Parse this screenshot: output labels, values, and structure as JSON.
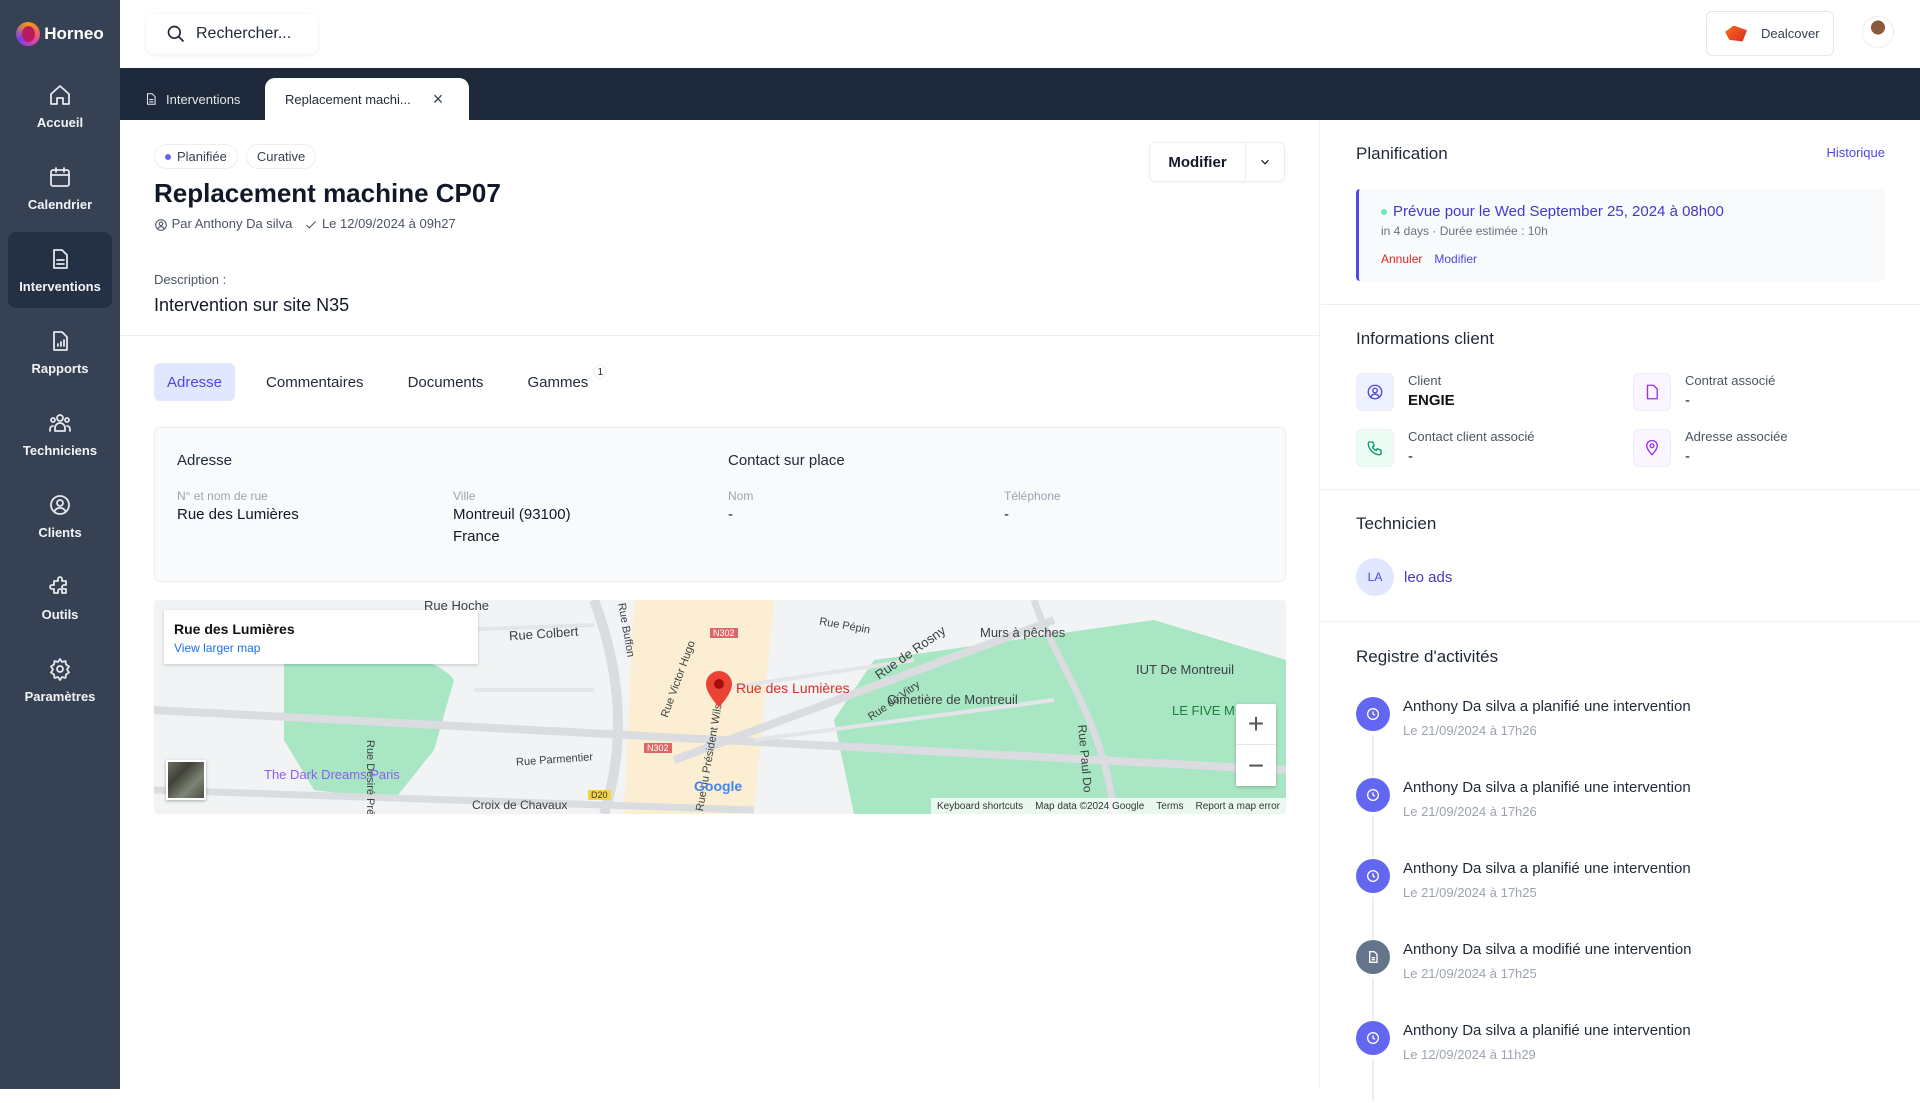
{
  "app": {
    "name": "Horneo"
  },
  "sidebar": {
    "items": [
      {
        "label": "Accueil",
        "icon": "home-icon"
      },
      {
        "label": "Calendrier",
        "icon": "calendar-icon"
      },
      {
        "label": "Interventions",
        "icon": "document-icon",
        "active": true
      },
      {
        "label": "Rapports",
        "icon": "report-icon"
      },
      {
        "label": "Techniciens",
        "icon": "users-icon"
      },
      {
        "label": "Clients",
        "icon": "user-circle-icon"
      },
      {
        "label": "Outils",
        "icon": "puzzle-icon"
      },
      {
        "label": "Paramètres",
        "icon": "gear-icon"
      }
    ]
  },
  "topbar": {
    "search_placeholder": "Rechercher...",
    "org_name": "Dealcover"
  },
  "tabs": [
    {
      "label": "Interventions"
    },
    {
      "label": "Replacement machi..."
    }
  ],
  "intervention": {
    "status": "Planifiée",
    "type": "Curative",
    "title": "Replacement machine CP07",
    "author": "Par Anthony Da silva",
    "date": "Le 12/09/2024 à 09h27",
    "modify_label": "Modifier",
    "description_label": "Description :",
    "description": "Intervention sur site N35"
  },
  "subtabs": [
    {
      "label": "Adresse",
      "active": true
    },
    {
      "label": "Commentaires"
    },
    {
      "label": "Documents"
    },
    {
      "label": "Gammes",
      "count": "1"
    }
  ],
  "address": {
    "title": "Adresse",
    "street_label": "N° et nom de rue",
    "street": "Rue des Lumières",
    "city_label": "Ville",
    "city": "Montreuil (93100)",
    "country": "France",
    "contact_title": "Contact sur place",
    "name_label": "Nom",
    "name": "-",
    "phone_label": "Téléphone",
    "phone": "-"
  },
  "map": {
    "info_title": "Rue des Lumières",
    "info_link": "View larger map",
    "pin_label": "Rue des Lumières",
    "labels": [
      "Rue Colbert",
      "Rue Hoche",
      "Rue Parmentier",
      "Rue Désiré Préaux",
      "Croix de Chavaux",
      "The Dark Dreams Paris",
      "Rue Victor Hugo",
      "Rue Buffon",
      "Rue Pépin",
      "Rue de Rosny",
      "Rue de Vitry",
      "Cimetière de Montreuil",
      "Murs à pêches",
      "IUT De Montreuil",
      "LE FIVE M",
      "Rue Paul Do",
      "Rue du Président Wilson",
      "N302",
      "N302",
      "D20"
    ],
    "footer": [
      "Keyboard shortcuts",
      "Map data ©2024 Google",
      "Terms",
      "Report a map error"
    ],
    "zoom_in": "+",
    "zoom_out": "−",
    "brand": "Google"
  },
  "planning": {
    "title": "Planification",
    "history_link": "Historique",
    "scheduled": "Prévue pour le Wed September 25, 2024 à 08h00",
    "sub": "in 4 days · Durée estimée : 10h",
    "cancel": "Annuler",
    "modify": "Modifier"
  },
  "client_info": {
    "title": "Informations client",
    "items": [
      {
        "label": "Client",
        "value": "ENGIE"
      },
      {
        "label": "Contrat associé",
        "value": "-"
      },
      {
        "label": "Contact client associé",
        "value": "-"
      },
      {
        "label": "Adresse associée",
        "value": "-"
      }
    ]
  },
  "technician": {
    "title": "Technicien",
    "initials": "LA",
    "name": "leo ads"
  },
  "activity": {
    "title": "Registre d'activités",
    "items": [
      {
        "text": "Anthony Da silva a planifié une intervention",
        "time": "Le 21/09/2024 à 17h26",
        "type": "planned"
      },
      {
        "text": "Anthony Da silva a planifié une intervention",
        "time": "Le 21/09/2024 à 17h26",
        "type": "planned"
      },
      {
        "text": "Anthony Da silva a planifié une intervention",
        "time": "Le 21/09/2024 à 17h25",
        "type": "planned"
      },
      {
        "text": "Anthony Da silva a modifié une intervention",
        "time": "Le 21/09/2024 à 17h25",
        "type": "modified"
      },
      {
        "text": "Anthony Da silva a planifié une intervention",
        "time": "Le 12/09/2024 à 11h29",
        "type": "planned"
      }
    ]
  },
  "colors": {
    "accent": "#4f46e5",
    "sidebar": "#364154",
    "tabbar": "#1e293b",
    "danger": "#dc2626"
  }
}
